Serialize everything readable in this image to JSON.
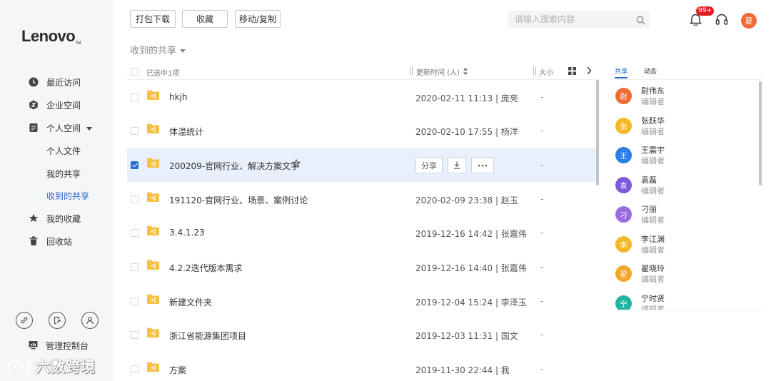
{
  "brand": {
    "logo": "Lenovo"
  },
  "sidebar": {
    "items": [
      {
        "label": "最近访问",
        "icon": "clock-icon"
      },
      {
        "label": "企业空间",
        "icon": "building-icon"
      },
      {
        "label": "个人空间",
        "icon": "document-icon"
      },
      {
        "label": "个人文件"
      },
      {
        "label": "我的共享"
      },
      {
        "label": "收到的共享"
      },
      {
        "label": "我的收藏",
        "icon": "star-icon"
      },
      {
        "label": "回收站",
        "icon": "trash-icon"
      }
    ],
    "console_label": "管理控制台",
    "watermark": "六数跨境"
  },
  "toolbar": {
    "pack_download": "打包下载",
    "favorite": "收藏",
    "move_copy": "移动/复制"
  },
  "search": {
    "placeholder": "请输入搜索内容"
  },
  "notifications": {
    "badge": "99+"
  },
  "user": {
    "avatar_letter": "夏"
  },
  "breadcrumb": "收到的共享",
  "list": {
    "header": {
      "selected_count": "已选中1项",
      "updated_col": "更新时间 (人)",
      "size_col": "大小"
    },
    "row_actions": {
      "share": "分享"
    },
    "rows": [
      {
        "name": "hkjh",
        "time": "2020-02-11 11:13 | 庞亮",
        "size": "-"
      },
      {
        "name": "体温统计",
        "time": "2020-02-10 17:55 | 杨洋",
        "size": "-"
      },
      {
        "name": "200209-官网行业、解决方案文字",
        "time": "",
        "size": "-"
      },
      {
        "name": "191120-官网行业、场景、案例讨论",
        "time": "2020-02-09 23:38 | 赵玉",
        "size": "-"
      },
      {
        "name": "3.4.1.23",
        "time": "2019-12-16 14:42 | 张嘉伟",
        "size": "-"
      },
      {
        "name": "4.2.2迭代版本需求",
        "time": "2019-12-16 14:40 | 张嘉伟",
        "size": "-"
      },
      {
        "name": "新建文件夹",
        "time": "2019-12-04 15:24 | 李泽玉",
        "size": "-"
      },
      {
        "name": "浙江省能源集团项目",
        "time": "2019-12-03 11:31 | 国文",
        "size": "-"
      },
      {
        "name": "方案",
        "time": "2019-11-30 22:44 | 我",
        "size": "-"
      }
    ]
  },
  "panel": {
    "tabs": [
      "共享",
      "动态"
    ],
    "members": [
      {
        "initial": "尉",
        "name": "尉伟东",
        "role": "编辑者",
        "color": "#f06a35"
      },
      {
        "initial": "张",
        "name": "张跃华",
        "role": "编辑者",
        "color": "#f5b72a"
      },
      {
        "initial": "王",
        "name": "王震宇",
        "role": "编辑者",
        "color": "#2a7ee8"
      },
      {
        "initial": "袁",
        "name": "袁磊",
        "role": "编辑者",
        "color": "#7a5bd8"
      },
      {
        "initial": "刁",
        "name": "刁丽",
        "role": "编辑者",
        "color": "#9b6ce0"
      },
      {
        "initial": "李",
        "name": "李江渊",
        "role": "编辑者",
        "color": "#f5b72a"
      },
      {
        "initial": "翟",
        "name": "翟晓玲",
        "role": "编辑者",
        "color": "#f5a62a"
      },
      {
        "initial": "宁",
        "name": "宁时贤",
        "role": "编辑者",
        "color": "#22b4a0"
      }
    ]
  },
  "colors": {
    "accent": "#2a6ccf",
    "folder": "#f7c244"
  }
}
